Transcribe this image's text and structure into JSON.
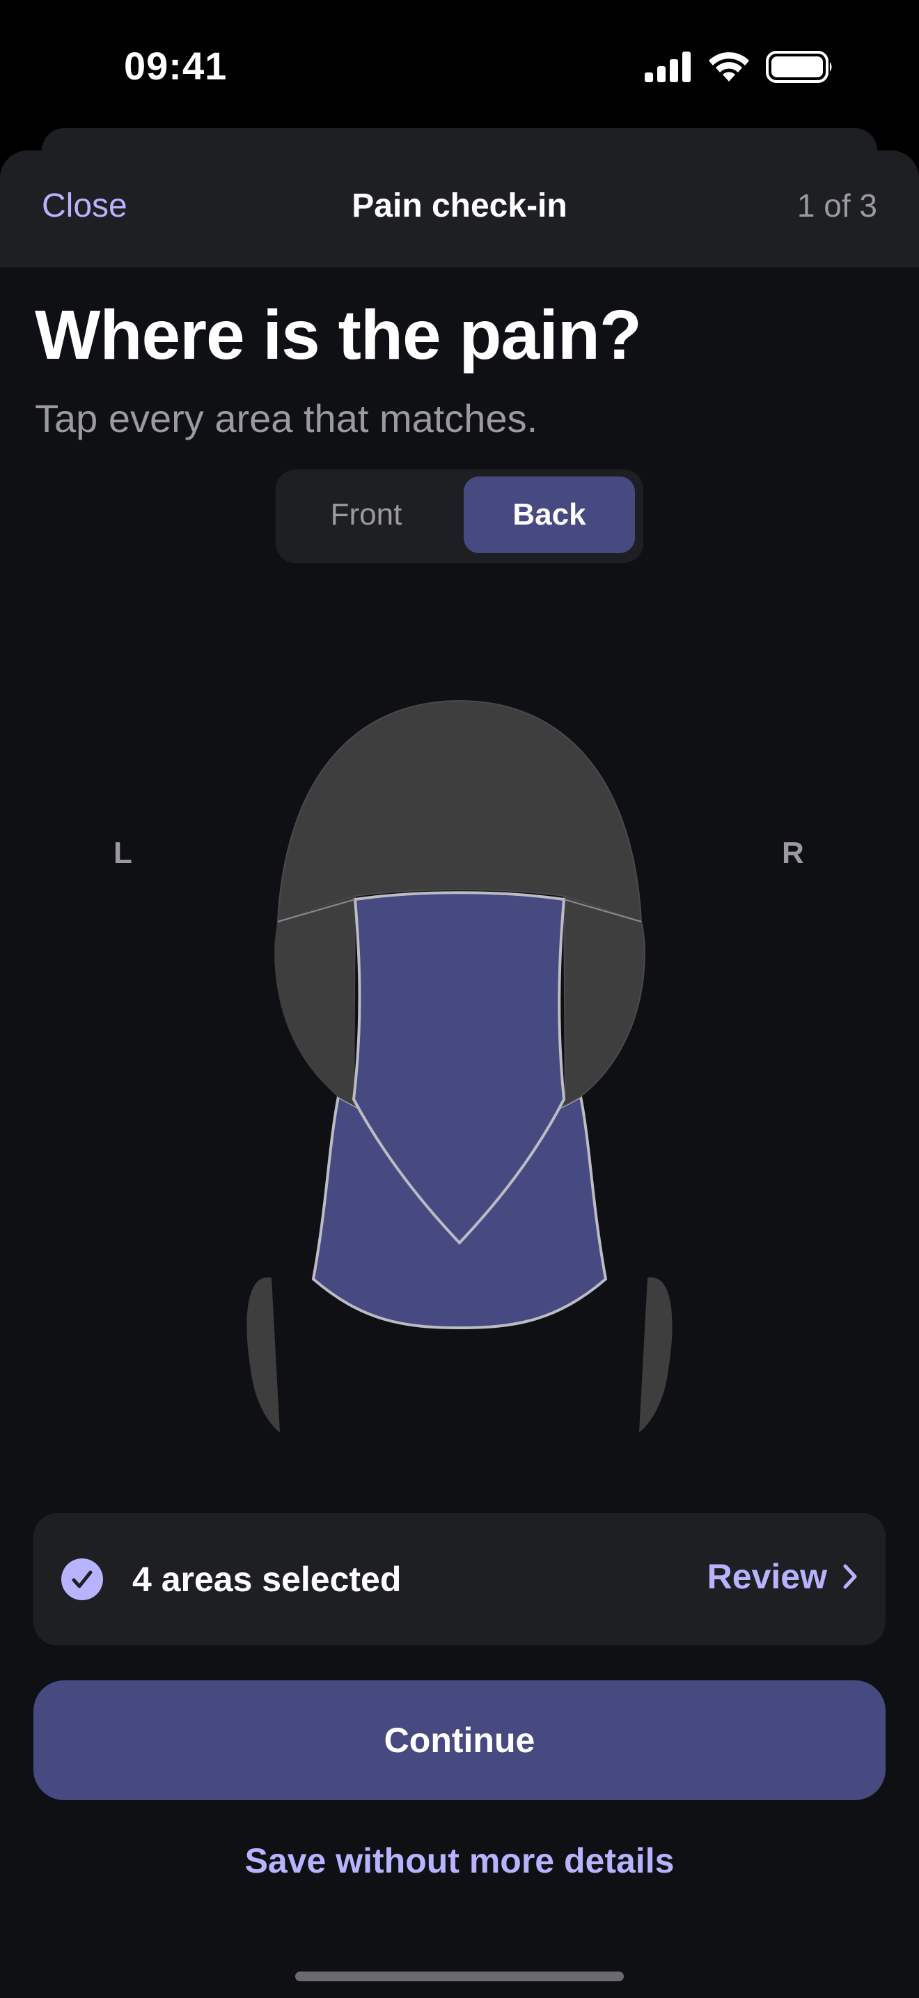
{
  "status_bar": {
    "time": "09:41"
  },
  "nav": {
    "close_label": "Close",
    "title": "Pain check-in",
    "step": "1 of 3"
  },
  "main": {
    "title": "Where is the pain?",
    "subtitle": "Tap every area that matches."
  },
  "view_toggle": {
    "options": [
      "Front",
      "Back"
    ],
    "selected": "Back"
  },
  "body_map": {
    "view": "back",
    "side_left": "L",
    "side_right": "R",
    "regions": [
      {
        "name": "crown",
        "selected": false
      },
      {
        "name": "upper-back-head-center",
        "selected": true
      },
      {
        "name": "left-back-head",
        "selected": false
      },
      {
        "name": "right-back-head",
        "selected": false
      },
      {
        "name": "left-ear",
        "selected": false
      },
      {
        "name": "right-ear",
        "selected": false
      },
      {
        "name": "neck-back",
        "selected": true
      }
    ]
  },
  "summary": {
    "text": "4 areas selected",
    "review_label": "Review",
    "icon": "checkmark-circle-icon"
  },
  "actions": {
    "continue_label": "Continue",
    "save_label": "Save without more details"
  },
  "colors": {
    "accent": "#b7b3ff",
    "selected_fill": "#474a80",
    "unselected_fill": "#3e3e3e",
    "background": "#0f1014",
    "surface": "#1e1f22"
  }
}
